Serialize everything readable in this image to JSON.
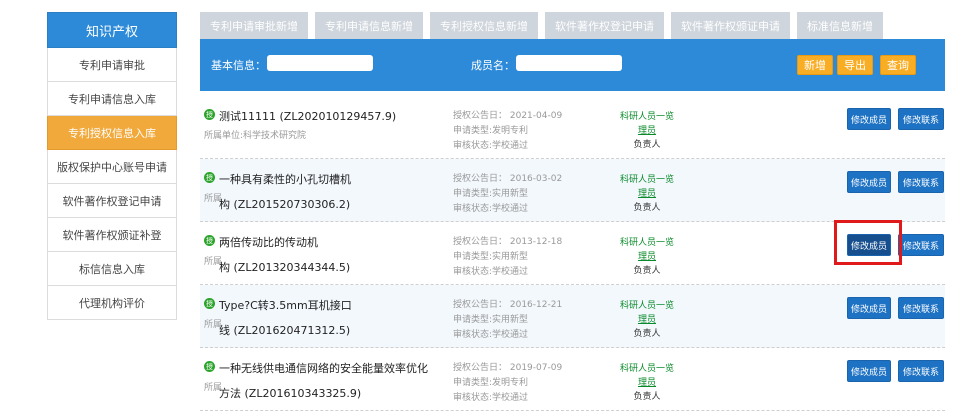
{
  "sidebar": {
    "title": "知识产权",
    "items": [
      {
        "label": "专利申请审批"
      },
      {
        "label": "专利申请信息入库"
      },
      {
        "label": "专利授权信息入库"
      },
      {
        "label": "版权保护中心账号申请"
      },
      {
        "label": "软件著作权登记申请"
      },
      {
        "label": "软件著作权颁证补登"
      },
      {
        "label": "标信信息入库"
      },
      {
        "label": "代理机构评价"
      }
    ]
  },
  "tabs": [
    {
      "label": "专利申请审批新增"
    },
    {
      "label": "专利申请信息新增"
    },
    {
      "label": "专利授权信息新增"
    },
    {
      "label": "软件著作权登记申请"
    },
    {
      "label": "软件著作权颁证申请"
    },
    {
      "label": "标准信息新增"
    }
  ],
  "search": {
    "basic_label": "基本信息：",
    "member_label": "成员名：",
    "basic_value": "",
    "member_value": "",
    "add_label": "新增",
    "export_label": "导出",
    "query_label": "查询"
  },
  "records": [
    {
      "badge": "授",
      "title": "测试11111 (ZL202010129457.9)",
      "title2": "",
      "unit": "所属单位:科学技术研究院",
      "date": "授权公告日：  2021-04-09",
      "type": "申请类型:发明专利",
      "status": "审核状态:学校通过",
      "role1": "科研人员一览",
      "role2": "理员",
      "role3": "负责人",
      "btn_member": "修改成员",
      "btn_contact": "修改联系"
    },
    {
      "badge": "授",
      "title": "一种具有柔性的小孔切槽机",
      "title2": "构 (ZL201520730306.2)",
      "unit": "所属",
      "date": "授权公告日：  2016-03-02",
      "type": "申请类型:实用新型",
      "status": "审核状态:学校通过",
      "role1": "科研人员一览",
      "role2": "理员",
      "role3": "负责人",
      "btn_member": "修改成员",
      "btn_contact": "修改联系"
    },
    {
      "badge": "授",
      "title": "两倍传动比的传动机",
      "title2": "构 (ZL201320344344.5)",
      "unit": "所属",
      "date": "授权公告日：  2013-12-18",
      "type": "申请类型:实用新型",
      "status": "审核状态:学校通过",
      "role1": "科研人员一览",
      "role2": "理员",
      "role3": "负责人",
      "btn_member": "修改成员",
      "btn_contact": "修改联系"
    },
    {
      "badge": "授",
      "title": "Type?C转3.5mm耳机接口",
      "title2": "线 (ZL201620471312.5)",
      "unit": "所属",
      "date": "授权公告日：  2016-12-21",
      "type": "申请类型:实用新型",
      "status": "审核状态:学校通过",
      "role1": "科研人员一览",
      "role2": "理员",
      "role3": "负责人",
      "btn_member": "修改成员",
      "btn_contact": "修改联系"
    },
    {
      "badge": "授",
      "title": "一种无线供电通信网络的安全能量效率优化",
      "title2": "方法 (ZL201610343325.9)",
      "unit": "所属",
      "date": "授权公告日：  2019-07-09",
      "type": "申请类型:发明专利",
      "status": "审核状态:学校通过",
      "role1": "科研人员一览",
      "role2": "理员",
      "role3": "负责人",
      "btn_member": "修改成员",
      "btn_contact": "修改联系"
    }
  ],
  "colors": {
    "primary": "#2c8ad8",
    "active": "#f2a93b",
    "action": "#f8ad24",
    "highlight": "#e01a1a"
  }
}
